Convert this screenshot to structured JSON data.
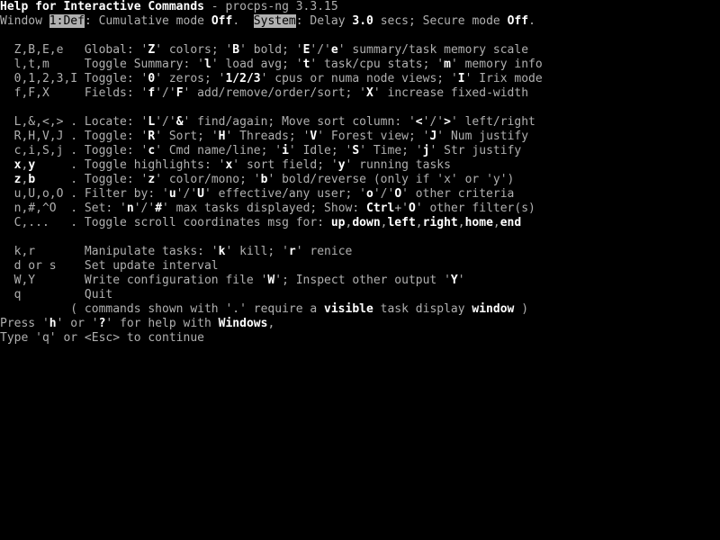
{
  "title": "Help for Interactive Commands",
  "pkg": " - procps-ng 3.3.15",
  "l2": {
    "a": "Window ",
    "win": "1:Def",
    "b": ": Cumulative mode ",
    "off1": "Off",
    "c": ".  ",
    "sys": "System",
    "d": ": Delay ",
    "delay": "3.0",
    "e": " secs; Secure mode ",
    "off2": "Off",
    "f": "."
  },
  "rows": [
    {
      "k": "  Z,B,E,e   Global: '",
      "p": [
        [
          "Z",
          "' colors; '"
        ],
        [
          "B",
          "' bold; '"
        ],
        [
          "E",
          "'/'"
        ],
        [
          "e",
          "' summary/task memory scale"
        ]
      ]
    },
    {
      "k": "  l,t,m     Toggle Summary: '",
      "p": [
        [
          "l",
          "' load avg; '"
        ],
        [
          "t",
          "' task/cpu stats; '"
        ],
        [
          "m",
          "' memory info"
        ]
      ]
    },
    {
      "k": "  0,1,2,3,I Toggle: '",
      "p": [
        [
          "0",
          "' zeros; '"
        ],
        [
          "1/2/3",
          "' cpus or numa node views; '"
        ],
        [
          "I",
          "' Irix mode"
        ]
      ]
    },
    {
      "k": "  f,F,X     Fields: '",
      "p": [
        [
          "f",
          "'/'"
        ],
        [
          "F",
          "' add/remove/order/sort; '"
        ],
        [
          "X",
          "' increase fixed-width"
        ]
      ]
    }
  ],
  "rows2": [
    {
      "k": "  L,&,<,> . Locate: '",
      "p": [
        [
          "L",
          "'/'"
        ],
        [
          "&",
          "' find/again; Move sort column: '"
        ],
        [
          "<",
          "'/'"
        ],
        [
          ">",
          "' left/right"
        ]
      ]
    },
    {
      "k": "  R,H,V,J . Toggle: '",
      "p": [
        [
          "R",
          "' Sort; '"
        ],
        [
          "H",
          "' Threads; '"
        ],
        [
          "V",
          "' Forest view; '"
        ],
        [
          "J",
          "' Num justify"
        ]
      ]
    },
    {
      "k": "  c,i,S,j . Toggle: '",
      "p": [
        [
          "c",
          "' Cmd name/line; '"
        ],
        [
          "i",
          "' Idle; '"
        ],
        [
          "S",
          "' Time; '"
        ],
        [
          "j",
          "' Str justify"
        ]
      ]
    },
    {
      "k": "  x",
      "k2": ",",
      "k3": "y",
      "t": "     . Toggle highlights: '",
      "p": [
        [
          "x",
          "' sort field; '"
        ],
        [
          "y",
          "' running tasks"
        ]
      ]
    },
    {
      "k": "  z",
      "k2": ",",
      "k3": "b",
      "t": "     . Toggle: '",
      "p": [
        [
          "z",
          "' color/mono; '"
        ],
        [
          "b",
          "' bold/reverse (only if 'x' or 'y')"
        ]
      ]
    },
    {
      "k": "  u,U,o,O . Filter by: '",
      "p": [
        [
          "u",
          "'/'"
        ],
        [
          "U",
          "' effective/any user; '"
        ],
        [
          "o",
          "'/'"
        ],
        [
          "O",
          "' other criteria"
        ]
      ]
    },
    {
      "k": "  n,#,^O  . Set: '",
      "p": [
        [
          "n",
          "'/'"
        ],
        [
          "#",
          "' max tasks displayed; Show: "
        ],
        [
          "Ctrl",
          "+'"
        ],
        [
          "O",
          "' other filter(s)"
        ]
      ]
    },
    {
      "k": "  C,...   . Toggle scroll coordinates msg for: ",
      "p": [
        [
          "up",
          ","
        ],
        [
          "down",
          ","
        ],
        [
          "left",
          ","
        ],
        [
          "right",
          ","
        ],
        [
          "home",
          ","
        ],
        [
          "end",
          ""
        ]
      ]
    }
  ],
  "rows3": [
    {
      "k": "  k,r       Manipulate tasks: '",
      "p": [
        [
          "k",
          "' kill; '"
        ],
        [
          "r",
          "' renice"
        ]
      ]
    },
    {
      "k": "  d or s    Set update interval",
      "p": []
    },
    {
      "k": "  W,Y       Write configuration file '",
      "p": [
        [
          "W",
          "'; Inspect other output '"
        ],
        [
          "Y",
          "'"
        ]
      ]
    },
    {
      "k": "  q         Quit",
      "p": []
    }
  ],
  "foot": {
    "a": "          ( commands shown with '.' require a ",
    "v": "visible",
    "b": " task display ",
    "w": "window",
    "c": " )"
  },
  "press": {
    "a": "Press '",
    "h": "h",
    "b": "' or '",
    "q": "?",
    "c": "' for help with ",
    "w": "Windows",
    "d": ","
  },
  "cont": "Type 'q' or <Esc> to continue"
}
